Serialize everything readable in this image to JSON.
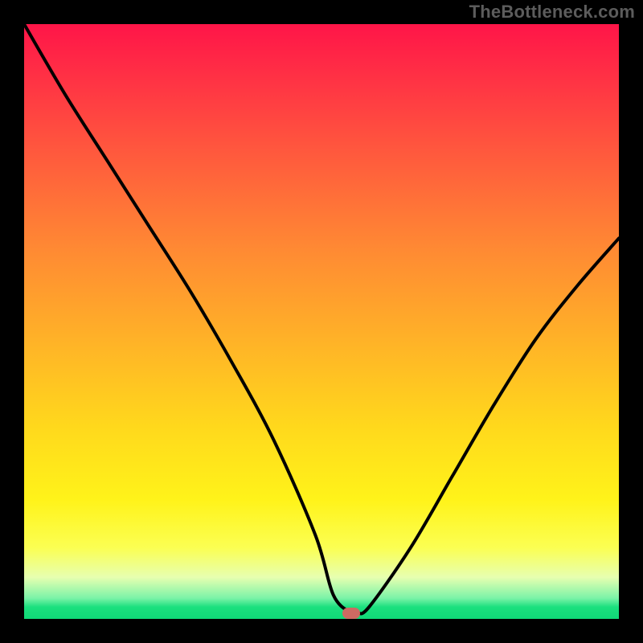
{
  "watermark": "TheBottleneck.com",
  "chart_data": {
    "type": "line",
    "title": "",
    "xlabel": "",
    "ylabel": "",
    "xlim": [
      0,
      100
    ],
    "ylim": [
      0,
      100
    ],
    "grid": false,
    "legend": false,
    "gradient_stops": [
      {
        "pos": 0,
        "color": "#ff1548"
      },
      {
        "pos": 8,
        "color": "#ff2e45"
      },
      {
        "pos": 22,
        "color": "#ff5a3d"
      },
      {
        "pos": 38,
        "color": "#ff8a33"
      },
      {
        "pos": 55,
        "color": "#ffb726"
      },
      {
        "pos": 68,
        "color": "#ffd91c"
      },
      {
        "pos": 80,
        "color": "#fff31a"
      },
      {
        "pos": 88,
        "color": "#fbff52"
      },
      {
        "pos": 93,
        "color": "#e7ffb0"
      },
      {
        "pos": 96.5,
        "color": "#7cf3a8"
      },
      {
        "pos": 98,
        "color": "#1be07e"
      },
      {
        "pos": 100,
        "color": "#10d977"
      }
    ],
    "series": [
      {
        "name": "bottleneck-curve",
        "x": [
          0,
          7,
          14,
          21,
          28,
          35,
          42,
          49,
          52,
          55,
          56,
          58,
          65,
          72,
          79,
          86,
          93,
          100
        ],
        "y": [
          100,
          88,
          77,
          66,
          55,
          43,
          30,
          14,
          4,
          1,
          1,
          2,
          12,
          24,
          36,
          47,
          56,
          64
        ]
      }
    ],
    "marker": {
      "x": 55,
      "y": 1,
      "color": "#cd6a62"
    }
  }
}
